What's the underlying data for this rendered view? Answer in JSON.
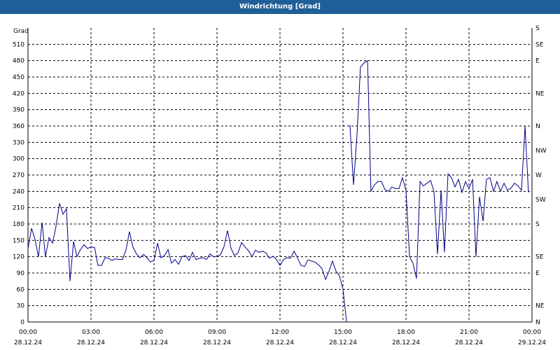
{
  "window": {
    "title": "Windrichtung [Grad]"
  },
  "chart_data": {
    "type": "line",
    "title": "Windrichtung [Grad]",
    "ylabel": "Grad",
    "ylim": [
      0,
      540
    ],
    "y_ticks": [
      0,
      30,
      60,
      90,
      120,
      150,
      180,
      210,
      240,
      270,
      300,
      330,
      360,
      390,
      420,
      450,
      480,
      510
    ],
    "xlim": [
      0,
      24
    ],
    "x_ticks": [
      0,
      3,
      6,
      9,
      12,
      15,
      18,
      21,
      24
    ],
    "x_tick_labels": [
      [
        "00:00",
        "28.12.24"
      ],
      [
        "03:00",
        "28.12.24"
      ],
      [
        "06:00",
        "28.12.24"
      ],
      [
        "09:00",
        "28.12.24"
      ],
      [
        "12:00",
        "28.12.24"
      ],
      [
        "15:00",
        "28.12.24"
      ],
      [
        "18:00",
        "28.12.24"
      ],
      [
        "21:00",
        "28.12.24"
      ],
      [
        "00:00",
        "29.12.24"
      ]
    ],
    "right_axis_labels": [
      {
        "y": 0,
        "label": "N"
      },
      {
        "y": 30,
        "label": "NE"
      },
      {
        "y": 90,
        "label": "E"
      },
      {
        "y": 120,
        "label": "SE"
      },
      {
        "y": 180,
        "label": "S"
      },
      {
        "y": 225,
        "label": "SW"
      },
      {
        "y": 270,
        "label": "W"
      },
      {
        "y": 315,
        "label": "NW"
      },
      {
        "y": 360,
        "label": "N"
      },
      {
        "y": 420,
        "label": "NE"
      },
      {
        "y": 480,
        "label": "E"
      },
      {
        "y": 510,
        "label": "SE"
      },
      {
        "y": 540,
        "label": "S"
      }
    ],
    "grid": true,
    "line_color": "#00008b",
    "series": [
      {
        "segments": [
          [
            [
              0.0,
              135
            ],
            [
              0.17,
              172
            ],
            [
              0.33,
              152
            ],
            [
              0.5,
              120
            ],
            [
              0.67,
              183
            ],
            [
              0.83,
              120
            ],
            [
              1.0,
              155
            ],
            [
              1.17,
              145
            ],
            [
              1.33,
              175
            ],
            [
              1.5,
              218
            ],
            [
              1.67,
              198
            ],
            [
              1.83,
              208
            ],
            [
              2.0,
              75
            ],
            [
              2.17,
              148
            ],
            [
              2.33,
              120
            ],
            [
              2.5,
              133
            ],
            [
              2.67,
              142
            ],
            [
              2.83,
              135
            ],
            [
              3.0,
              138
            ],
            [
              3.17,
              137
            ],
            [
              3.33,
              104
            ],
            [
              3.5,
              104
            ],
            [
              3.67,
              118
            ],
            [
              3.83,
              117
            ],
            [
              4.0,
              113
            ],
            [
              4.17,
              116
            ],
            [
              4.33,
              115
            ],
            [
              4.5,
              115
            ],
            [
              4.67,
              133
            ],
            [
              4.83,
              166
            ],
            [
              5.0,
              137
            ],
            [
              5.17,
              125
            ],
            [
              5.33,
              118
            ],
            [
              5.5,
              124
            ],
            [
              5.67,
              118
            ],
            [
              5.83,
              110
            ],
            [
              6.0,
              113
            ],
            [
              6.17,
              145
            ],
            [
              6.33,
              118
            ],
            [
              6.5,
              122
            ],
            [
              6.67,
              133
            ],
            [
              6.83,
              108
            ],
            [
              7.0,
              115
            ],
            [
              7.17,
              106
            ],
            [
              7.33,
              120
            ],
            [
              7.5,
              122
            ],
            [
              7.67,
              113
            ],
            [
              7.83,
              128
            ],
            [
              8.0,
              115
            ],
            [
              8.17,
              117
            ],
            [
              8.33,
              118
            ],
            [
              8.5,
              115
            ],
            [
              8.67,
              125
            ],
            [
              8.83,
              120
            ],
            [
              9.0,
              120
            ],
            [
              9.17,
              124
            ],
            [
              9.33,
              138
            ],
            [
              9.5,
              168
            ],
            [
              9.67,
              135
            ],
            [
              9.83,
              122
            ],
            [
              10.0,
              127
            ],
            [
              10.17,
              146
            ],
            [
              10.33,
              138
            ],
            [
              10.5,
              131
            ],
            [
              10.67,
              120
            ],
            [
              10.83,
              132
            ],
            [
              11.0,
              128
            ],
            [
              11.17,
              130
            ],
            [
              11.33,
              127
            ],
            [
              11.5,
              117
            ],
            [
              11.67,
              121
            ],
            [
              11.83,
              115
            ],
            [
              12.0,
              104
            ],
            [
              12.17,
              115
            ],
            [
              12.33,
              118
            ],
            [
              12.5,
              117
            ],
            [
              12.67,
              130
            ],
            [
              12.83,
              118
            ],
            [
              13.0,
              104
            ],
            [
              13.17,
              102
            ],
            [
              13.33,
              114
            ],
            [
              13.5,
              112
            ],
            [
              13.67,
              110
            ],
            [
              13.83,
              105
            ],
            [
              14.0,
              98
            ],
            [
              14.17,
              78
            ],
            [
              14.33,
              93
            ],
            [
              14.5,
              112
            ],
            [
              14.67,
              93
            ],
            [
              14.83,
              85
            ],
            [
              15.0,
              60
            ],
            [
              15.17,
              0
            ]
          ],
          [
            [
              15.33,
              362
            ],
            [
              15.5,
              252
            ],
            [
              15.67,
              345
            ],
            [
              15.83,
              468
            ],
            [
              16.0,
              476
            ],
            [
              16.17,
              480
            ],
            [
              16.33,
              240
            ],
            [
              16.5,
              252
            ],
            [
              16.67,
              258
            ],
            [
              16.83,
              258
            ],
            [
              17.0,
              243
            ],
            [
              17.17,
              240
            ],
            [
              17.33,
              248
            ],
            [
              17.5,
              245
            ],
            [
              17.67,
              245
            ],
            [
              17.83,
              265
            ],
            [
              18.0,
              242
            ],
            [
              18.17,
              120
            ],
            [
              18.33,
              108
            ],
            [
              18.5,
              80
            ],
            [
              18.67,
              258
            ],
            [
              18.83,
              250
            ],
            [
              19.0,
              255
            ],
            [
              19.17,
              260
            ],
            [
              19.33,
              240
            ],
            [
              19.5,
              125
            ],
            [
              19.67,
              242
            ],
            [
              19.83,
              128
            ],
            [
              20.0,
              272
            ],
            [
              20.17,
              265
            ],
            [
              20.33,
              248
            ],
            [
              20.5,
              262
            ],
            [
              20.67,
              238
            ],
            [
              20.83,
              258
            ],
            [
              21.0,
              245
            ],
            [
              21.17,
              262
            ],
            [
              21.33,
              120
            ],
            [
              21.5,
              230
            ],
            [
              21.67,
              185
            ],
            [
              21.83,
              262
            ],
            [
              22.0,
              265
            ],
            [
              22.17,
              240
            ],
            [
              22.33,
              258
            ],
            [
              22.5,
              240
            ],
            [
              22.67,
              255
            ],
            [
              22.83,
              242
            ],
            [
              23.0,
              246
            ],
            [
              23.17,
              255
            ],
            [
              23.33,
              250
            ],
            [
              23.5,
              242
            ],
            [
              23.67,
              360
            ],
            [
              23.83,
              238
            ]
          ]
        ]
      }
    ]
  }
}
